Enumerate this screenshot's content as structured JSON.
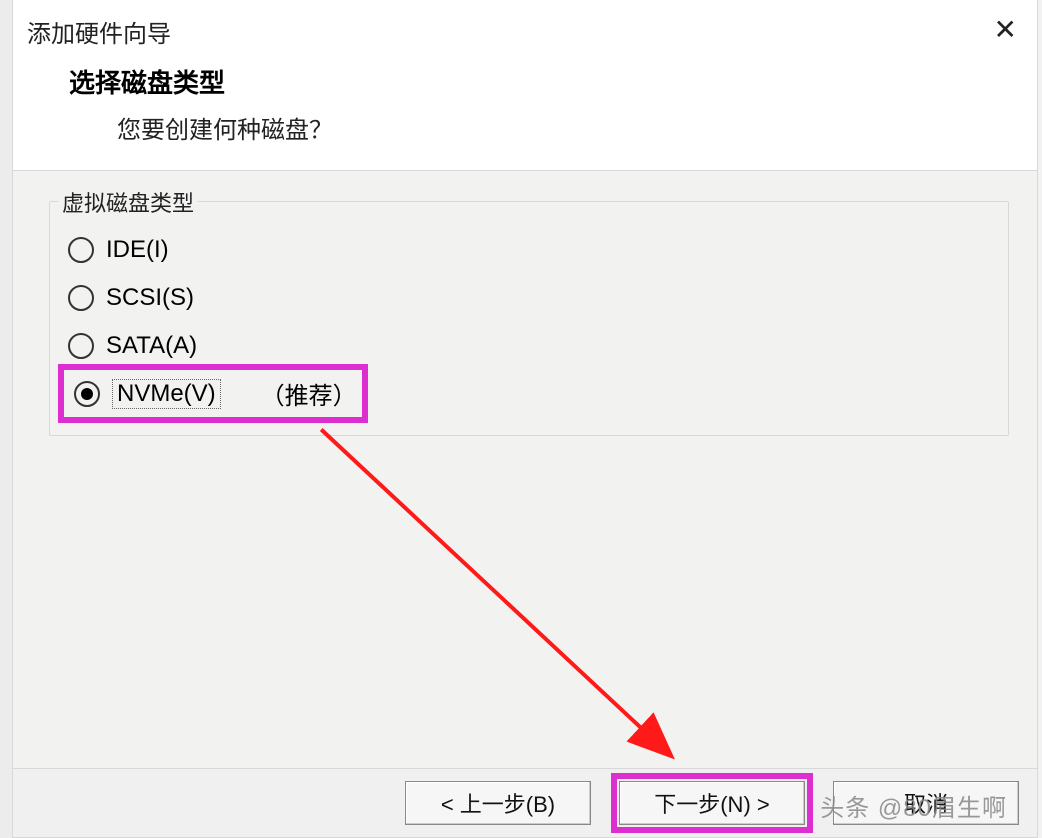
{
  "window": {
    "title": "添加硬件向导"
  },
  "header": {
    "title": "选择磁盘类型",
    "subtitle": "您要创建何种磁盘？"
  },
  "group": {
    "label": "虚拟磁盘类型",
    "options": {
      "ide": "IDE(I)",
      "scsi": "SCSI(S)",
      "sata": "SATA(A)",
      "nvme": "NVMe(V)",
      "nvme_recommend": "（推荐）"
    }
  },
  "footer": {
    "back": "< 上一步(B)",
    "next": "下一步(N) >",
    "cancel": "取消"
  },
  "watermark": "头条 @80眉生啊"
}
